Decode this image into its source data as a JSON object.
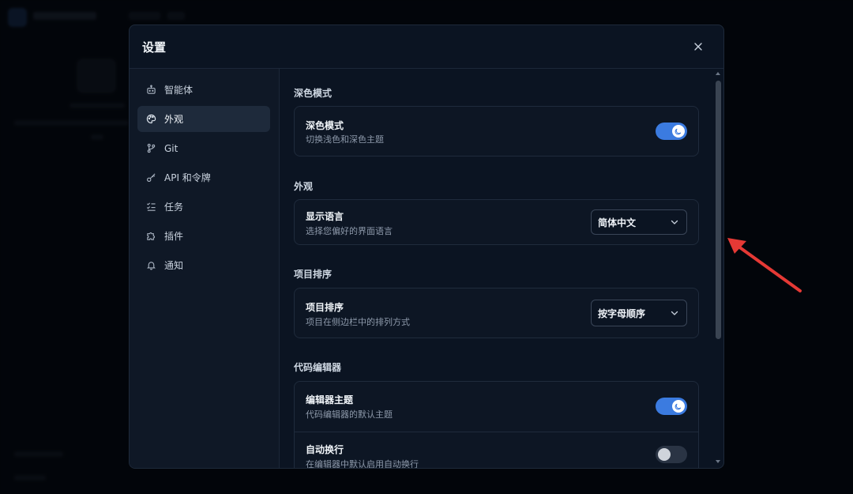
{
  "dialog": {
    "title": "设置"
  },
  "sidebar": {
    "items": [
      {
        "label": "智能体",
        "icon": "bot-icon",
        "active": false
      },
      {
        "label": "外观",
        "icon": "palette-icon",
        "active": true
      },
      {
        "label": "Git",
        "icon": "git-branch-icon",
        "active": false
      },
      {
        "label": "API 和令牌",
        "icon": "key-icon",
        "active": false
      },
      {
        "label": "任务",
        "icon": "task-list-icon",
        "active": false
      },
      {
        "label": "插件",
        "icon": "puzzle-icon",
        "active": false
      },
      {
        "label": "通知",
        "icon": "bell-icon",
        "active": false
      }
    ]
  },
  "sections": {
    "dark_mode": {
      "title": "深色模式",
      "row": {
        "title": "深色模式",
        "desc": "切换浅色和深色主题",
        "toggle_on": true
      }
    },
    "appearance": {
      "title": "外观",
      "row": {
        "title": "显示语言",
        "desc": "选择您偏好的界面语言",
        "select_value": "简体中文"
      }
    },
    "project_sort": {
      "title": "项目排序",
      "row": {
        "title": "项目排序",
        "desc": "项目在侧边栏中的排列方式",
        "select_value": "按字母顺序"
      }
    },
    "code_editor": {
      "title": "代码编辑器",
      "rows": [
        {
          "title": "编辑器主题",
          "desc": "代码编辑器的默认主题",
          "toggle_on": true
        },
        {
          "title": "自动换行",
          "desc": "在编辑器中默认启用自动换行",
          "toggle_on": false
        }
      ]
    }
  },
  "colors": {
    "accent": "#3b7be0",
    "annotation_arrow": "#e53935",
    "background": "#0b1422"
  }
}
